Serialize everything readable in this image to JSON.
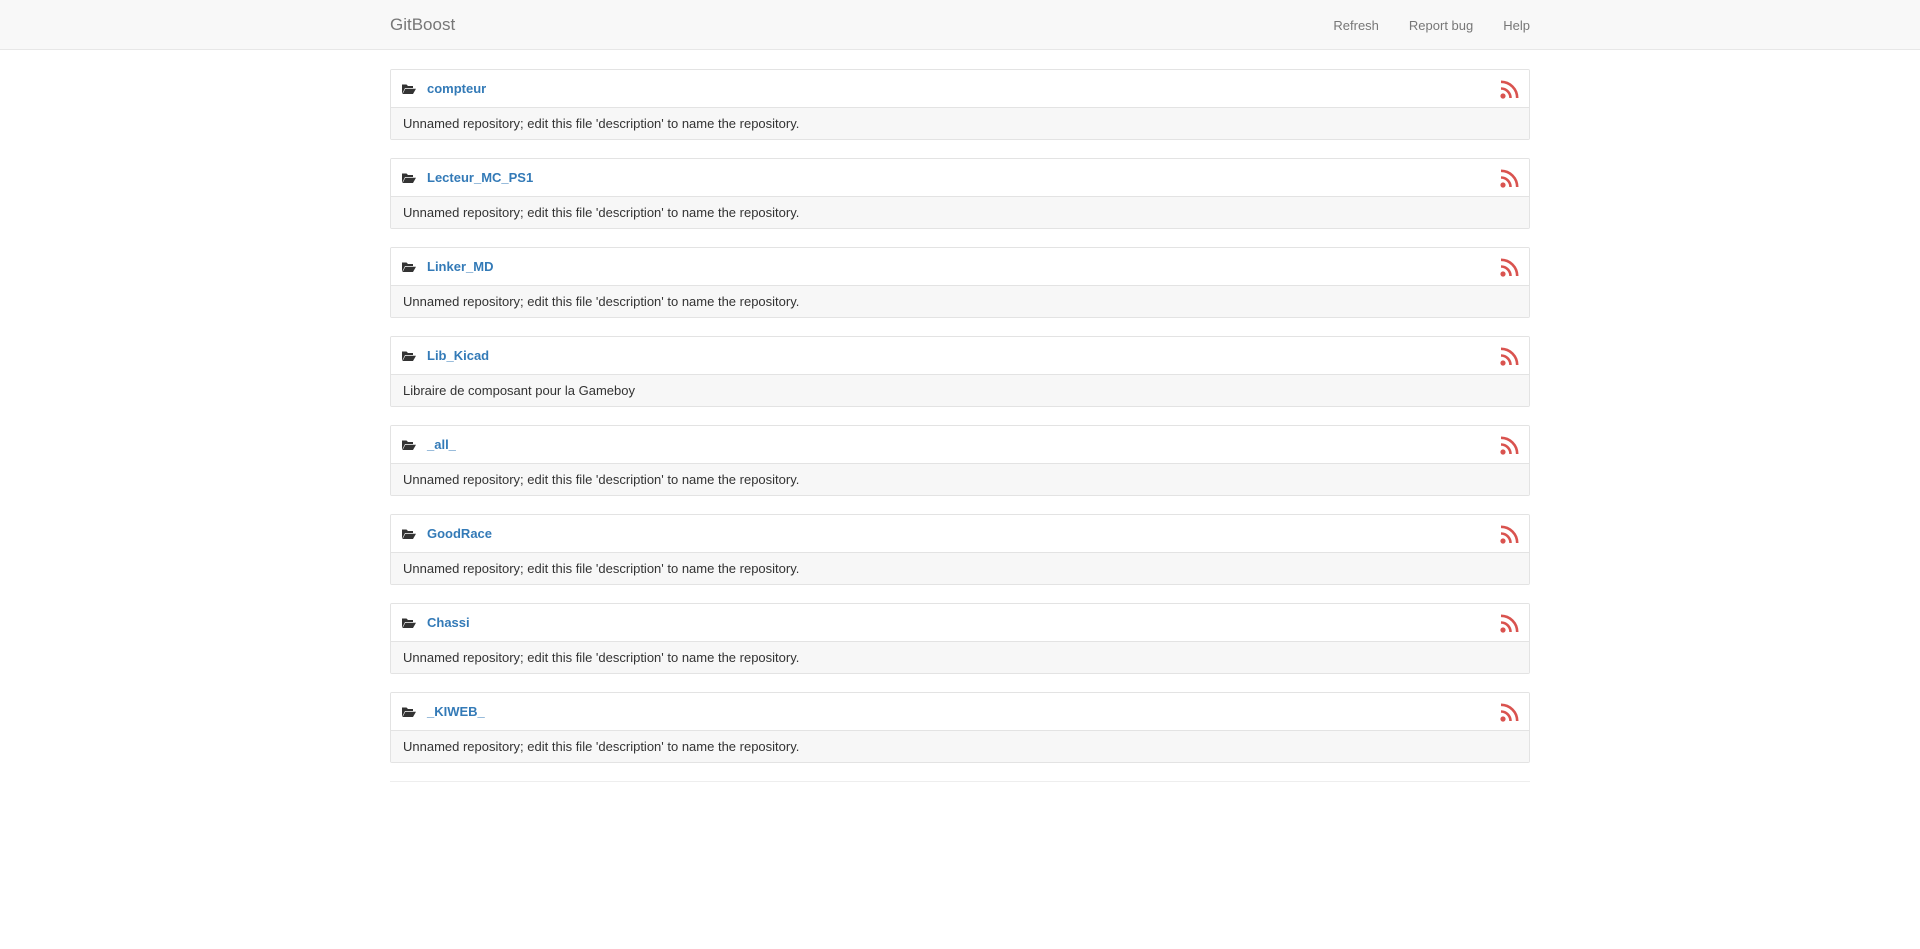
{
  "navbar": {
    "brand": "GitBoost",
    "links": [
      "Refresh",
      "Report bug",
      "Help"
    ]
  },
  "repos": [
    {
      "name": "compteur",
      "description": "Unnamed repository; edit this file 'description' to name the repository."
    },
    {
      "name": "Lecteur_MC_PS1",
      "description": "Unnamed repository; edit this file 'description' to name the repository."
    },
    {
      "name": "Linker_MD",
      "description": "Unnamed repository; edit this file 'description' to name the repository."
    },
    {
      "name": "Lib_Kicad",
      "description": "Libraire de composant pour la Gameboy"
    },
    {
      "name": "_all_",
      "description": "Unnamed repository; edit this file 'description' to name the repository."
    },
    {
      "name": "GoodRace",
      "description": "Unnamed repository; edit this file 'description' to name the repository."
    },
    {
      "name": "Chassi",
      "description": "Unnamed repository; edit this file 'description' to name the repository."
    },
    {
      "name": "_KIWEB_",
      "description": "Unnamed repository; edit this file 'description' to name the repository."
    }
  ],
  "icons": {
    "folder": "folder-open-icon",
    "feed": "rss-feed-icon"
  },
  "colors": {
    "link": "#337ab7",
    "rss": "#d9534f",
    "navbar_bg": "#f8f8f8"
  }
}
